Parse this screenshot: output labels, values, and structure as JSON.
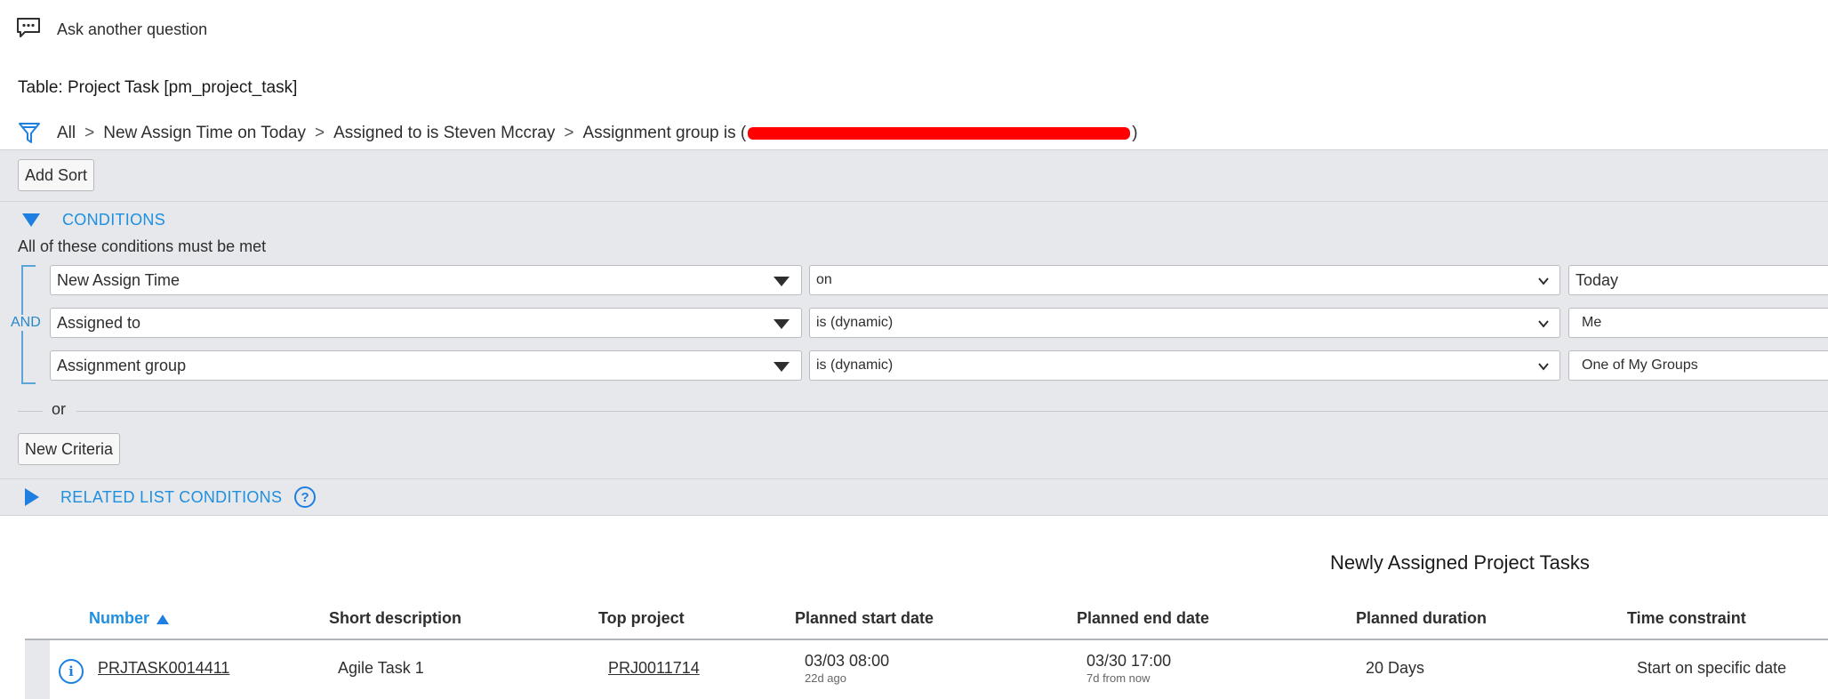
{
  "ask": {
    "label": "Ask another question"
  },
  "table": {
    "name": "Table: Project Task [pm_project_task]"
  },
  "breadcrumb": {
    "items": [
      "All",
      "New Assign Time on Today",
      "Assigned to is Steven Mccray",
      "Assignment group is ("
    ],
    "closing": ")",
    "separator": ">"
  },
  "filter": {
    "add_sort_label": "Add Sort",
    "conditions_title": "CONDITIONS",
    "all_met_text": "All of these conditions must be met",
    "and_label": "AND",
    "rows": [
      {
        "field": "New Assign Time",
        "operator": "on",
        "value": "Today"
      },
      {
        "field": "Assigned to",
        "operator": "is (dynamic)",
        "value": "Me"
      },
      {
        "field": "Assignment group",
        "operator": "is (dynamic)",
        "value": "One of My Groups"
      }
    ],
    "or_label": "or",
    "new_criteria_label": "New Criteria",
    "related_title": "RELATED LIST CONDITIONS",
    "help_glyph": "?"
  },
  "list": {
    "title": "Newly Assigned Project Tasks",
    "columns": [
      "Number",
      "Short description",
      "Top project",
      "Planned start date",
      "Planned end date",
      "Planned duration",
      "Time constraint"
    ],
    "rows": [
      {
        "number": "PRJTASK0014411",
        "short_description": "Agile Task 1",
        "top_project": "PRJ0011714",
        "start_date": "03/03 08:00",
        "start_rel": "22d ago",
        "end_date": "03/30 17:00",
        "end_rel": "7d from now",
        "duration": "20 Days",
        "time_constraint": "Start on specific date"
      }
    ]
  },
  "icons": {
    "chat": "chat-bubble-icon",
    "filter": "filter-funnel-icon",
    "info": "info-icon"
  },
  "colors": {
    "accent": "#1f8fe0",
    "panel_bg": "#e6e8eb",
    "redaction": "#ff0000"
  }
}
